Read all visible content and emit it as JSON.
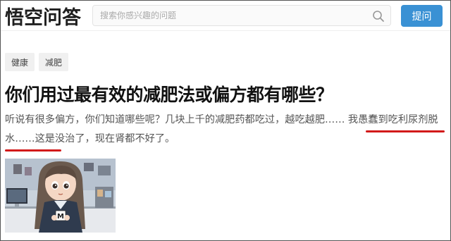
{
  "header": {
    "logo_text": "悟空问答",
    "search_placeholder": "搜索你感兴趣的问题",
    "ask_button_label": "提问"
  },
  "tags": [
    "健康",
    "减肥"
  ],
  "question": {
    "title": "你们用过最有效的减肥法或偏方都有哪些？",
    "desc_part1": "听说有很多偏方，你们知道哪些呢？几块上千的减肥药都吃过，越吃越肥…… ",
    "desc_highlight1": "我愚蠢到吃利尿",
    "desc_highlight2": "剂脱水……",
    "desc_part2": "这是没治了，现在肾都不好了。"
  },
  "colors": {
    "accent": "#3a91d4",
    "underline": "#d21a1a"
  }
}
